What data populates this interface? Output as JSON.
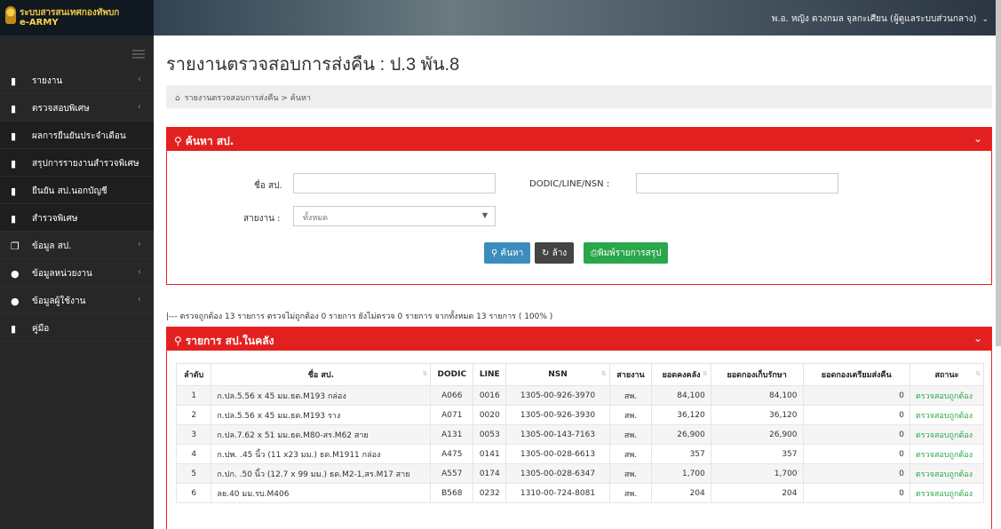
{
  "brand": {
    "title": "ระบบสารสนเทศกองทัพบก",
    "subtitle": "e-ARMY"
  },
  "user": {
    "name": "พ.อ. หญิง ดวงกมล จุลกะเศียน (ผู้ดูแลระบบส่วนกลาง)"
  },
  "sidebar": {
    "items": [
      {
        "label": "รายงาน",
        "chevron": "‹"
      },
      {
        "label": "ตรวจสอบพิเศษ",
        "chevron": "‹"
      },
      {
        "label": "ผลการยืนยันประจำเดือน",
        "chevron": ""
      },
      {
        "label": "สรุปการรายงานสำรวจพิเศษ",
        "chevron": ""
      },
      {
        "label": "ยืนยัน สป.นอกบัญชี",
        "chevron": ""
      },
      {
        "label": "สำรวจพิเศษ",
        "chevron": ""
      },
      {
        "label": "ข้อมูล สป.",
        "chevron": "‹"
      },
      {
        "label": "ข้อมูลหน่วยงาน",
        "chevron": "‹"
      },
      {
        "label": "ข้อมูลผู้ใช้งาน",
        "chevron": "‹"
      },
      {
        "label": "คู่มือ",
        "chevron": ""
      }
    ]
  },
  "page": {
    "title": "รายงานตรวจสอบการส่งคืน : ป.3 พัน.8"
  },
  "breadcrumb": {
    "parent": "รายงานตรวจสอบการส่งคืน",
    "separator": ">",
    "current": "ค้นหา"
  },
  "search": {
    "title": "ค้นหา สป.",
    "name_label": "ชื่อ สป.",
    "name_value": "",
    "nsn_label": "DODIC/LINE/NSN :",
    "nsn_value": "",
    "line_label": "สายงาน :",
    "line_selected": "ทั้งหมด",
    "search_button": "ค้นหา",
    "clear_button": "ล้าง",
    "print_button": "พิมพ์รายการสรุป"
  },
  "summary": {
    "text": "|--- ตรวจถูกต้อง 13 รายการ ตรวจไม่ถูกต้อง 0 รายการ ยังไม่ตรวจ 0 รายการ จากทั้งหมด 13 รายการ ( 100% )"
  },
  "list": {
    "title": "รายการ สป.ในคลัง",
    "columns": [
      "ลำดับ",
      "ชื่อ สป.",
      "DODIC",
      "LINE",
      "NSN",
      "สายงาน",
      "ยอดคงคลัง",
      "ยอดกองเก็บรักษา",
      "ยอดกองเตรียมส่งคืน",
      "สถานะ"
    ],
    "rows": [
      {
        "no": "1",
        "name": "ก.ปล.5.56 x 45 มม.ธด.M193 กล่อง",
        "dodic": "A066",
        "line": "0016",
        "nsn": "1305-00-926-3970",
        "branch": "สพ.",
        "stock": "84,100",
        "store": "84,100",
        "return": "0",
        "status": "ตรวจสอบถูกต้อง"
      },
      {
        "no": "2",
        "name": "ก.ปล.5.56 x 45 มม.ธด.M193 ราง",
        "dodic": "A071",
        "line": "0020",
        "nsn": "1305-00-926-3930",
        "branch": "สพ.",
        "stock": "36,120",
        "store": "36,120",
        "return": "0",
        "status": "ตรวจสอบถูกต้อง"
      },
      {
        "no": "3",
        "name": "ก.ปล.7.62 x 51 มม.ธด.M80-สร.M62 สาย",
        "dodic": "A131",
        "line": "0053",
        "nsn": "1305-00-143-7163",
        "branch": "สพ.",
        "stock": "26,900",
        "store": "26,900",
        "return": "0",
        "status": "ตรวจสอบถูกต้อง"
      },
      {
        "no": "4",
        "name": "ก.ปพ. .45 นิ้ว (11 x23 มม.) ธด.M1911 กล่อง",
        "dodic": "A475",
        "line": "0141",
        "nsn": "1305-00-028-6613",
        "branch": "สพ.",
        "stock": "357",
        "store": "357",
        "return": "0",
        "status": "ตรวจสอบถูกต้อง"
      },
      {
        "no": "5",
        "name": "ก.ปก. .50 นิ้ว (12.7 x 99 มม.) ธด.M2-1,สร.M17 สาย",
        "dodic": "A557",
        "line": "0174",
        "nsn": "1305-00-028-6347",
        "branch": "สพ.",
        "stock": "1,700",
        "store": "1,700",
        "return": "0",
        "status": "ตรวจสอบถูกต้อง"
      },
      {
        "no": "6",
        "name": "ลย.40 มม.รบ.M406",
        "dodic": "B568",
        "line": "0232",
        "nsn": "1310-00-724-8081",
        "branch": "สพ.",
        "stock": "204",
        "store": "204",
        "return": "0",
        "status": "ตรวจสอบถูกต้อง"
      }
    ]
  },
  "colors": {
    "accent": "#e32020",
    "sidebar": "#272727",
    "success": "#2aa74a",
    "primary": "#3c8dbc"
  }
}
